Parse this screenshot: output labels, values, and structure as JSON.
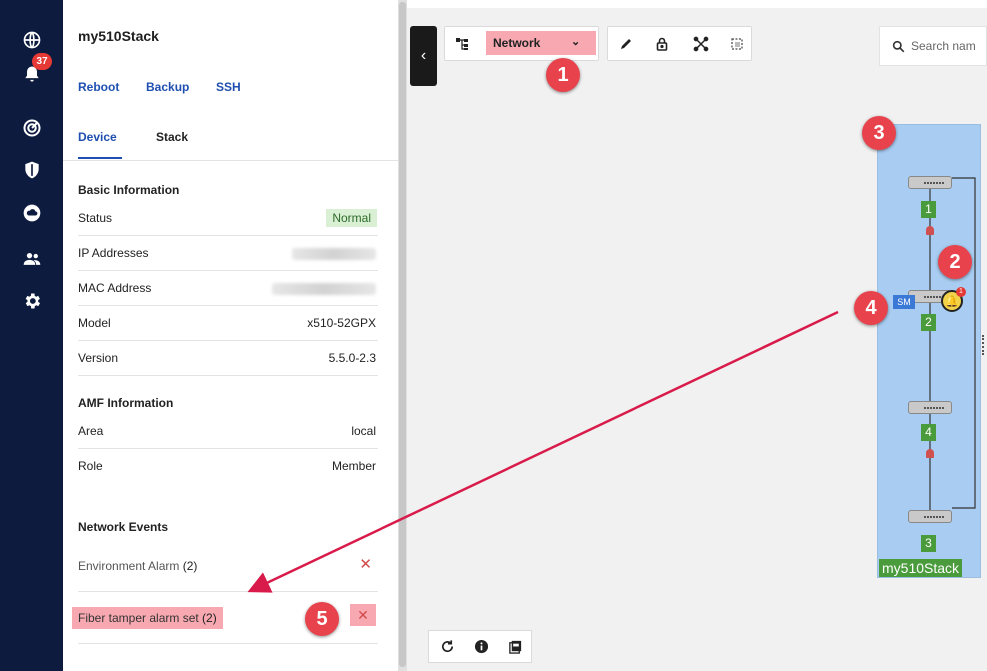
{
  "nav": {
    "alert_count": "37",
    "items": [
      {
        "icon": "globe-icon"
      },
      {
        "icon": "bell-icon"
      },
      {
        "icon": "radar-icon"
      },
      {
        "icon": "shield-icon"
      },
      {
        "icon": "cloud-icon"
      },
      {
        "icon": "users-icon"
      },
      {
        "icon": "gear-icon"
      }
    ]
  },
  "panel": {
    "title": "my510Stack",
    "actions": [
      "Reboot",
      "Backup",
      "SSH"
    ],
    "tabs": [
      {
        "label": "Device",
        "active": true
      },
      {
        "label": "Stack",
        "active": false
      }
    ],
    "basic_info": {
      "heading": "Basic Information",
      "status_label": "Status",
      "status_value": "Normal",
      "ip_label": "IP Addresses",
      "mac_label": "MAC Address",
      "model_label": "Model",
      "model_value": "x510-52GPX",
      "version_label": "Version",
      "version_value": "5.5.0-2.3"
    },
    "amf_info": {
      "heading": "AMF Information",
      "area_label": "Area",
      "area_value": "local",
      "role_label": "Role",
      "role_value": "Member"
    },
    "network_events": {
      "heading": "Network Events",
      "events": [
        {
          "name": "Environment Alarm",
          "count": "(2)",
          "highlighted": false
        },
        {
          "name": "Fiber tamper alarm set",
          "count": "(2)",
          "highlighted": true
        }
      ],
      "dismiss_glyph": "✕"
    }
  },
  "toolbar": {
    "view_select": "Network",
    "dropdown_glyph": "⌄",
    "collapse_glyph": "‹",
    "search_placeholder": "Search nam"
  },
  "topology": {
    "stack_name": "my510Stack",
    "units": [
      "1",
      "2",
      "4",
      "3"
    ],
    "master_tag": "SM",
    "alarm_count": "1"
  },
  "markers": [
    "1",
    "2",
    "3",
    "4",
    "5"
  ],
  "colors": {
    "nav_bg": "#0d1b3e",
    "link_blue": "#1f4fb0",
    "highlight_pink": "#f7a8b0",
    "marker_red": "#e8434c",
    "stack_blue": "#a9cdf2",
    "unit_green": "#4a9b3c",
    "arrow": "#d81b4a"
  }
}
